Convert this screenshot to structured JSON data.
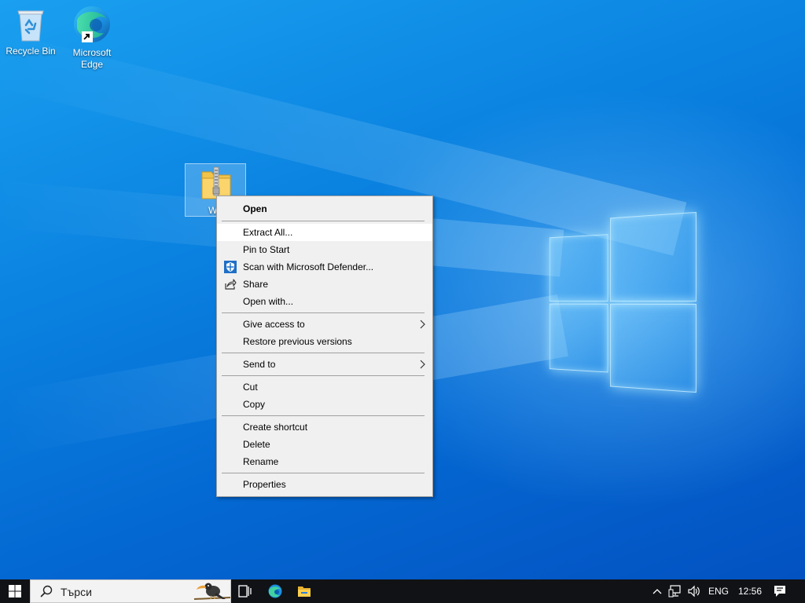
{
  "desktop": {
    "icons": [
      {
        "label_line1": "Recycle Bin",
        "label_line2": "",
        "icon": "recycle-bin-icon"
      },
      {
        "label_line1": "Microsoft",
        "label_line2": "Edge",
        "icon": "edge-icon"
      }
    ],
    "selected_file": {
      "label": "Wo",
      "icon": "zip-folder-icon"
    }
  },
  "context_menu": {
    "items": [
      {
        "label": "Open"
      },
      {
        "label": "Extract All..."
      },
      {
        "label": "Pin to Start"
      },
      {
        "label": "Scan with Microsoft Defender..."
      },
      {
        "label": "Share"
      },
      {
        "label": "Open with..."
      },
      {
        "label": "Give access to"
      },
      {
        "label": "Restore previous versions"
      },
      {
        "label": "Send to"
      },
      {
        "label": "Cut"
      },
      {
        "label": "Copy"
      },
      {
        "label": "Create shortcut"
      },
      {
        "label": "Delete"
      },
      {
        "label": "Rename"
      },
      {
        "label": "Properties"
      }
    ]
  },
  "taskbar": {
    "search_placeholder": "Търси",
    "language": "ENG",
    "time": "12:56"
  },
  "colors": {
    "taskbar": "#101216",
    "menu_bg": "#f0f0f0",
    "menu_hover": "#ffffff",
    "desktop_accent": "#0a82e0"
  }
}
